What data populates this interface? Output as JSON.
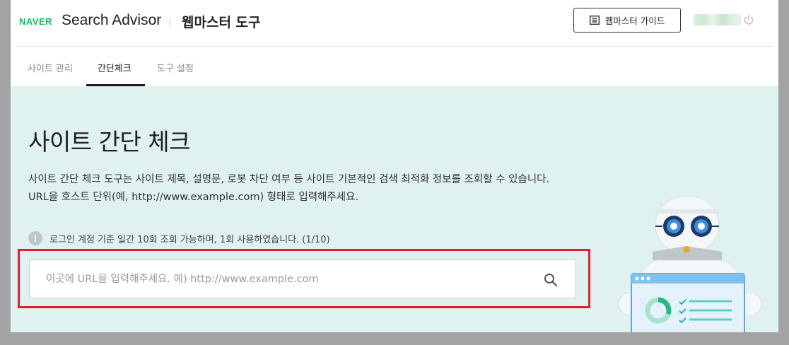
{
  "header": {
    "logo": "NAVER",
    "product": "Search Advisor",
    "tool": "웹마스터 도구",
    "guide_button": "웹마스터 가이드",
    "icons": {
      "guide": "book-icon",
      "logout": "power-icon"
    }
  },
  "tabs": [
    {
      "label": "사이트 관리",
      "active": false
    },
    {
      "label": "간단체크",
      "active": true
    },
    {
      "label": "도구 설정",
      "active": false
    }
  ],
  "main": {
    "title": "사이트 간단 체크",
    "description_line1": "사이트 간단 체크 도구는 사이트 제목, 설명문, 로봇 차단 여부 등 사이트 기본적인 검색 최적화 정보를 조회할 수 있습니다.",
    "description_line2": "URL을 호스트 단위(예, http://www.example.com) 형태로 입력해주세요.",
    "notice_icon": "!",
    "notice": "로그인 계정 기준 일간 10회 조회 가능하며, 1회 사용하였습니다. (1/10)",
    "search": {
      "placeholder": "이곳에 URL을 입력해주세요. 예) http://www.example.com",
      "value": ""
    }
  },
  "colors": {
    "brand": "#03c75a",
    "highlight": "#e2202b",
    "main_bg": "#dff2f0"
  }
}
